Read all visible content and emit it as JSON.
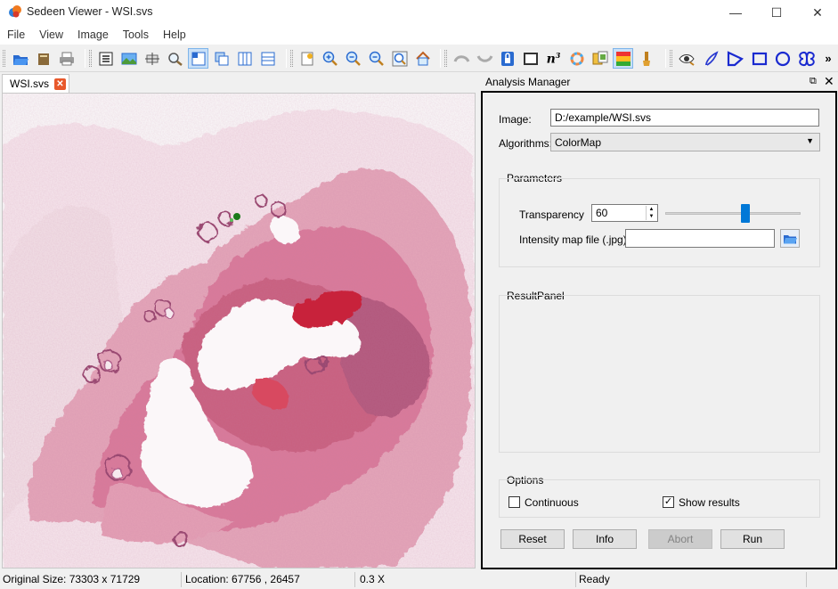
{
  "window": {
    "title": "Sedeen Viewer - WSI.svs",
    "minimize": "—",
    "maximize": "☐",
    "close": "✕"
  },
  "menu": [
    "File",
    "View",
    "Image",
    "Tools",
    "Help"
  ],
  "toolbar": {
    "icons": [
      "open-folder-icon",
      "open-recent-icon",
      "print-icon",
      "properties-icon",
      "image-thumbnail-icon",
      "crop-icon",
      "magnifier-icon",
      "layout-single-icon",
      "layout-overlay-icon",
      "layout-columns-icon",
      "layout-rows-icon",
      "snapshot-icon",
      "zoom-in-icon",
      "zoom-out-icon",
      "zoom-actual-icon",
      "zoom-fit-icon",
      "home-icon",
      "undo-icon",
      "redo-icon",
      "lock-icon",
      "frame-icon",
      "n-cubed-icon",
      "color-wheel-icon",
      "compare-icon",
      "heatmap-icon",
      "brush-icon",
      "eye-icon",
      "pen-icon",
      "polygon-icon",
      "rectangle-icon",
      "ellipse-icon",
      "spline-icon"
    ],
    "more": "»"
  },
  "tab": {
    "label": "WSI.svs",
    "close": "✕"
  },
  "analysis": {
    "title": "Analysis Manager",
    "float_icon": "⧉",
    "close_icon": "✕",
    "image_label": "Image:",
    "image_value": "D:/example/WSI.svs",
    "algorithms_label": "Algorithms:",
    "algorithm_value": "ColorMap",
    "parameters_label": "Parameters",
    "transparency_label": "Transparency",
    "transparency_value": "60",
    "transparency_fraction": 0.6,
    "intensity_label": "Intensity map file (.jpg)",
    "intensity_value": "",
    "result_label": "ResultPanel",
    "options_label": "Options",
    "continuous_label": "Continuous",
    "continuous_checked": false,
    "show_results_label": "Show results",
    "show_results_checked": true,
    "buttons": {
      "reset": "Reset",
      "info": "Info",
      "abort": "Abort",
      "run": "Run"
    }
  },
  "status": {
    "original_size": "Original Size: 73303 x 71729",
    "location": "Location: 67756 , 26457",
    "zoom": "0.3 X",
    "state": "Ready"
  },
  "colors": {
    "accent": "#0078d7",
    "tissue": "#d87a9a",
    "stroma": "#e6a4b8"
  }
}
